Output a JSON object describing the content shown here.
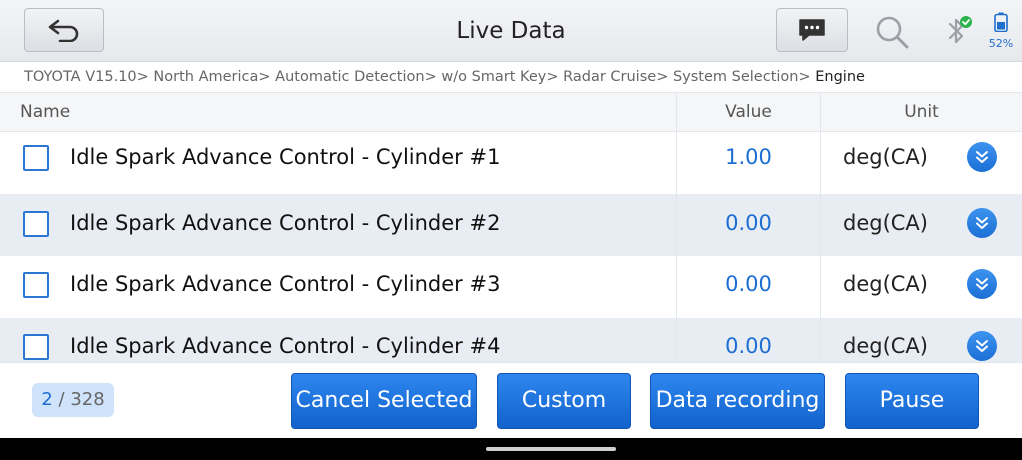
{
  "header": {
    "title": "Live Data",
    "icons": {
      "back": "back-arrow-icon",
      "message": "message-icon",
      "search": "search-icon",
      "bluetooth": "bluetooth-icon",
      "battery": "battery-icon"
    },
    "battery_percent": "52%"
  },
  "breadcrumb": [
    "TOYOTA V15.10",
    "North America",
    "Automatic Detection",
    "w/o Smart Key",
    "Radar Cruise",
    "System Selection",
    "Engine"
  ],
  "table": {
    "columns": {
      "name": "Name",
      "value": "Value",
      "unit": "Unit"
    },
    "rows": [
      {
        "name": "Idle Spark Advance Control - Cylinder #1",
        "value": "1.00",
        "unit": "deg(CA)"
      },
      {
        "name": "Idle Spark Advance Control - Cylinder #2",
        "value": "0.00",
        "unit": "deg(CA)"
      },
      {
        "name": "Idle Spark Advance Control - Cylinder #3",
        "value": "0.00",
        "unit": "deg(CA)"
      },
      {
        "name": "Idle Spark Advance Control - Cylinder #4",
        "value": "0.00",
        "unit": "deg(CA)"
      }
    ]
  },
  "pager": {
    "current": "2",
    "separator": "/",
    "total": "328"
  },
  "buttons": {
    "cancel_selected": "Cancel Selected",
    "custom": "Custom",
    "data_recording": "Data recording",
    "pause": "Pause"
  },
  "colors": {
    "accent": "#1c6ed2",
    "button_blue": "#1a6fdc",
    "row_alt": "#e8ecf3",
    "bluetooth_badge": "#2bb24c"
  }
}
